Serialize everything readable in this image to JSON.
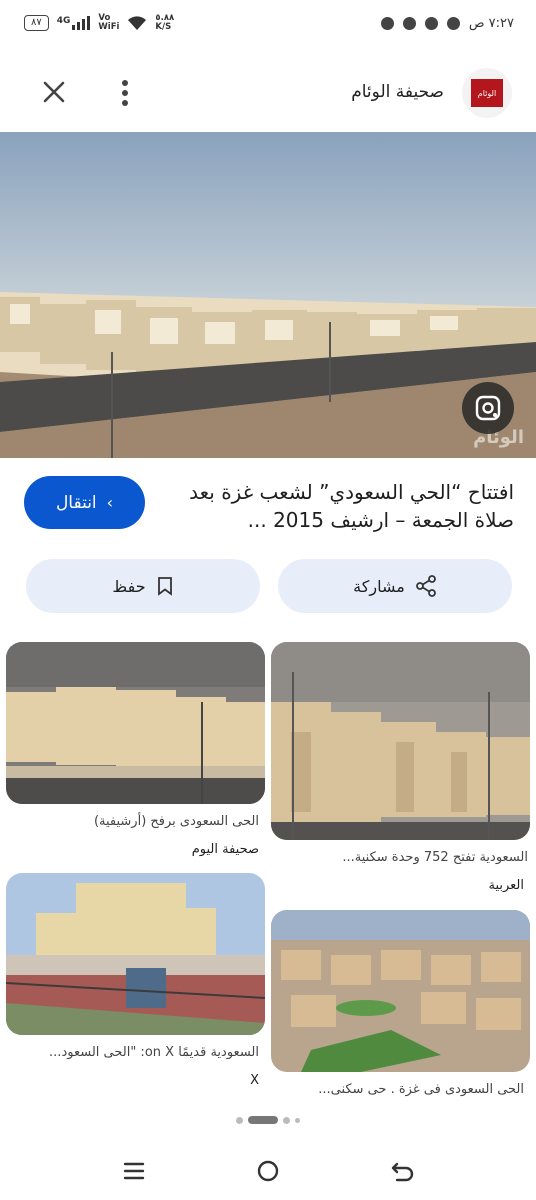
{
  "status": {
    "battery": "٨٧",
    "network": "4G",
    "volte": "Vo",
    "wifi_label": "WiFi",
    "speed_value": "٥.٨٨",
    "speed_unit": "K/S",
    "time": "٧:٢٧ ص"
  },
  "header": {
    "site_name": "صحيفة الوئام",
    "logo_text": "الوئام"
  },
  "hero": {
    "watermark": "الوئام"
  },
  "result": {
    "title": "افتتاح “الحي السعودي” لشعب غزة بعد صلاة الجمعة – ارشيف 2015 ...",
    "visit_label": "انتقال",
    "share_label": "مشاركة",
    "save_label": "حفظ"
  },
  "related": [
    {
      "caption": "السعودية تفتح 752 وحدة سكنية...",
      "source": "العربية"
    },
    {
      "caption": "الحى السعودى برفح (أرشيفية)",
      "source": "صحيفة اليوم"
    },
    {
      "caption": "الحى السعودى فى غزة . حى سكنى...",
      "source": ""
    },
    {
      "caption": "السعودية قديمًا on X: \"الحى السعود...",
      "source": "X"
    }
  ]
}
